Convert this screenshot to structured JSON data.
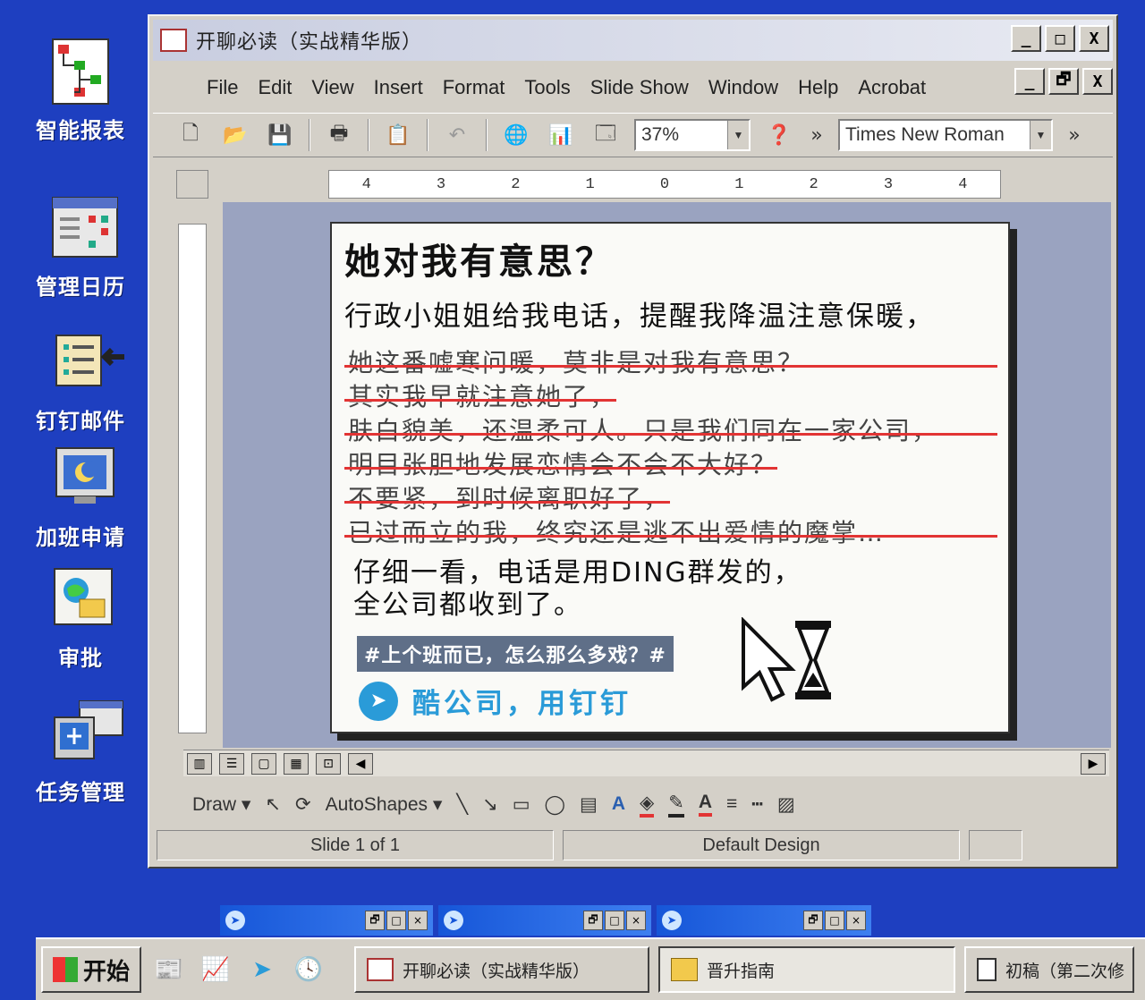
{
  "desktop": {
    "icons": [
      {
        "label": "智能报表",
        "icon": "org-chart-icon"
      },
      {
        "label": "管理日历",
        "icon": "calendar-grid-icon"
      },
      {
        "label": "钉钉邮件",
        "icon": "mail-list-icon"
      },
      {
        "label": "加班申请",
        "icon": "monitor-moon-icon"
      },
      {
        "label": "审批",
        "icon": "approval-globe-icon"
      },
      {
        "label": "任务管理",
        "icon": "task-window-icon"
      }
    ]
  },
  "window": {
    "title": "开聊必读（实战精华版）",
    "controls": {
      "minimize": "_",
      "maximize": "□",
      "close": "X",
      "restore": "🗗"
    },
    "menu": [
      "File",
      "Edit",
      "View",
      "Insert",
      "Format",
      "Tools",
      "Slide Show",
      "Window",
      "Help",
      "Acrobat"
    ],
    "toolbar": {
      "zoom": "37%",
      "font": "Times New Roman",
      "more": "»"
    },
    "ruler_labels": [
      "4",
      "3",
      "2",
      "1",
      "0",
      "1",
      "2",
      "3",
      "4"
    ],
    "slide": {
      "heading": "她对我有意思？",
      "lead": "行政小姐姐给我电话，提醒我降温注意保暖，",
      "struck_lines": [
        "她这番嘘寒问暖，莫非是对我有意思？",
        "其实我早就注意她了，",
        "肤白貌美，还温柔可人。只是我们同在一家公司，",
        "明目张胆地发展恋情会不会不大好？",
        "不要紧，到时候离职好了，",
        "已过而立的我，终究还是逃不出爱情的魔掌…"
      ],
      "reveal_lines": [
        "仔细一看，电话是用DING群发的，",
        "全公司都收到了。"
      ],
      "hashtag": "#上个班而已，怎么那么多戏？#",
      "brand": "酷公司，用钉钉"
    },
    "draw_toolbar": {
      "draw": "Draw ▾",
      "autoshapes": "AutoShapes ▾"
    },
    "status": {
      "slide": "Slide 1 of 1",
      "design": "Default Design"
    }
  },
  "taskbar": {
    "start": "开始",
    "tasks": [
      {
        "label": "开聊必读（实战精华版）",
        "active": false
      },
      {
        "label": "晋升指南",
        "active": true
      },
      {
        "label": "初稿（第二次修",
        "active": false
      }
    ]
  },
  "colors": {
    "desktop": "#1e3fc0",
    "strike": "#e23434",
    "brand": "#2a9bd8",
    "tag_bg": "#5f6f88"
  }
}
